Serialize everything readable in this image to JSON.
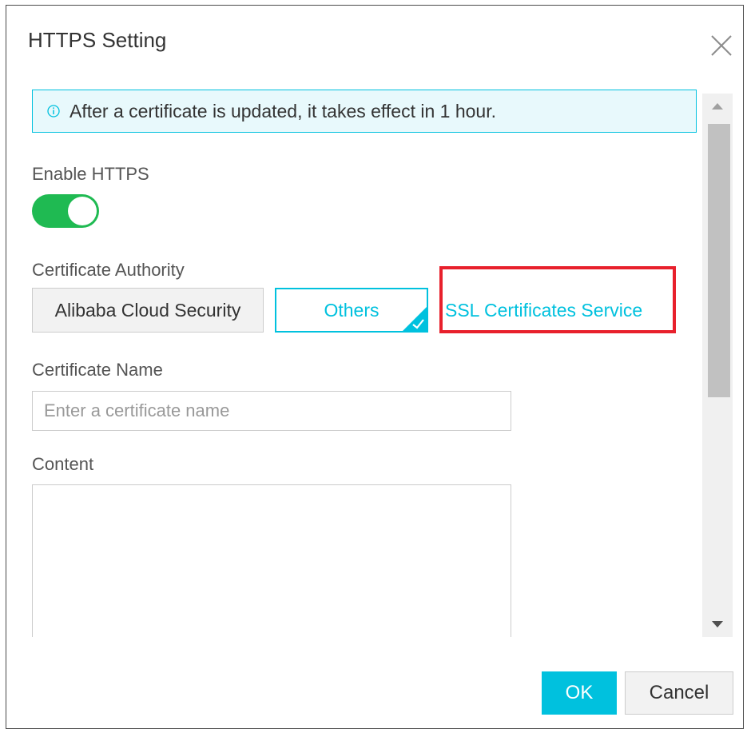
{
  "dialog": {
    "title": "HTTPS Setting",
    "close_icon": "close-icon"
  },
  "notice": {
    "icon": "info-icon",
    "text": "After a certificate is updated, it takes effect in 1 hour."
  },
  "enable_https": {
    "label": "Enable HTTPS",
    "enabled": true
  },
  "certificate_authority": {
    "label": "Certificate Authority",
    "options": [
      "Alibaba Cloud Security",
      "Others"
    ],
    "selected": "Others",
    "link": "SSL Certificates Service"
  },
  "certificate_name": {
    "label": "Certificate Name",
    "placeholder": "Enter a certificate name",
    "value": ""
  },
  "content": {
    "label": "Content",
    "value": ""
  },
  "footer": {
    "ok_label": "OK",
    "cancel_label": "Cancel"
  },
  "colors": {
    "accent": "#00c1de",
    "toggle_on": "#1fba52",
    "highlight_box": "#e8202c",
    "notice_bg": "#e8f9fc"
  }
}
